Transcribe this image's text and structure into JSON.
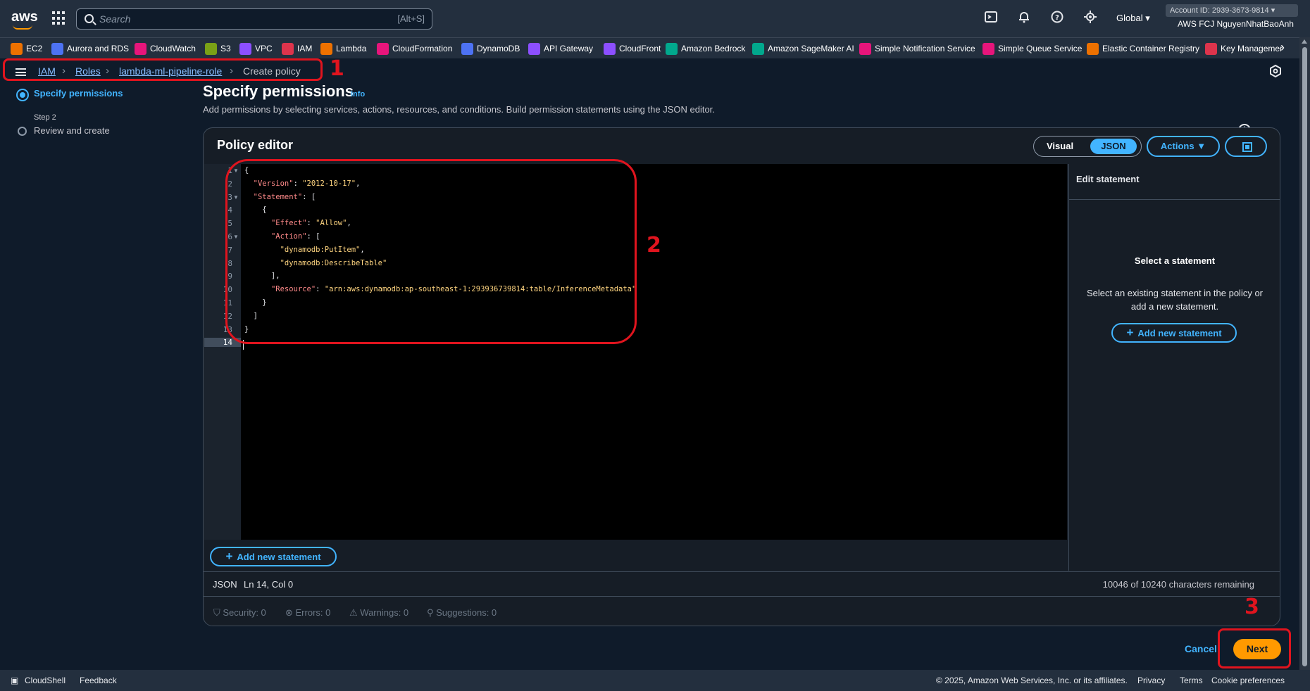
{
  "topbar": {
    "logo": "aws",
    "search_placeholder": "Search",
    "search_shortcut": "[Alt+S]",
    "region": "Global ▾",
    "account_id": "Account ID: 2939-3673-9814 ▾",
    "user": "AWS FCJ NguyenNhatBaoAnh"
  },
  "favorites": [
    {
      "label": "EC2",
      "color": "#ed7100"
    },
    {
      "label": "Aurora and RDS",
      "color": "#4d72f3"
    },
    {
      "label": "CloudWatch",
      "color": "#e7157b"
    },
    {
      "label": "S3",
      "color": "#7aa116"
    },
    {
      "label": "VPC",
      "color": "#8c4fff"
    },
    {
      "label": "IAM",
      "color": "#dd344c"
    },
    {
      "label": "Lambda",
      "color": "#ed7100"
    },
    {
      "label": "CloudFormation",
      "color": "#e7157b"
    },
    {
      "label": "DynamoDB",
      "color": "#4d72f3"
    },
    {
      "label": "API Gateway",
      "color": "#8c4fff"
    },
    {
      "label": "CloudFront",
      "color": "#8c4fff"
    },
    {
      "label": "Amazon Bedrock",
      "color": "#01a88d"
    },
    {
      "label": "Amazon SageMaker AI",
      "color": "#01a88d"
    },
    {
      "label": "Simple Notification Service",
      "color": "#e7157b"
    },
    {
      "label": "Simple Queue Service",
      "color": "#e7157b"
    },
    {
      "label": "Elastic Container Registry",
      "color": "#ed7100"
    },
    {
      "label": "Key Managemer",
      "color": "#dd344c"
    }
  ],
  "breadcrumb": [
    "IAM",
    "Roles",
    "lambda-ml-pipeline-role",
    "Create policy"
  ],
  "steps": {
    "step1": "Specify permissions",
    "step2_num": "Step 2",
    "step2": "Review and create"
  },
  "page": {
    "title": "Specify permissions",
    "info": "Info",
    "description": "Add permissions by selecting services, actions, resources, and conditions. Build permission statements using the JSON editor."
  },
  "editor": {
    "title": "Policy editor",
    "visual": "Visual",
    "json": "JSON",
    "actions": "Actions ▼",
    "lines": [
      {
        "n": "1",
        "text": "{"
      },
      {
        "n": "2",
        "text": "  \"Version\": \"2012-10-17\","
      },
      {
        "n": "3",
        "text": "  \"Statement\": ["
      },
      {
        "n": "4",
        "text": "    {"
      },
      {
        "n": "5",
        "text": "      \"Effect\": \"Allow\","
      },
      {
        "n": "6",
        "text": "      \"Action\": ["
      },
      {
        "n": "7",
        "text": "        \"dynamodb:PutItem\","
      },
      {
        "n": "8",
        "text": "        \"dynamodb:DescribeTable\""
      },
      {
        "n": "9",
        "text": "      ],"
      },
      {
        "n": "10",
        "text": "      \"Resource\": \"arn:aws:dynamodb:ap-southeast-1:293936739814:table/InferenceMetadata\""
      },
      {
        "n": "11",
        "text": "    }"
      },
      {
        "n": "12",
        "text": "  ]"
      },
      {
        "n": "13",
        "text": "}"
      },
      {
        "n": "14",
        "text": ""
      }
    ],
    "add_statement": "Add new statement",
    "status_mode": "JSON",
    "status_pos": "Ln 14, Col 0",
    "chars_remaining": "10046 of 10240 characters remaining",
    "checks": [
      "Security: 0",
      "Errors: 0",
      "Warnings: 0",
      "Suggestions: 0"
    ]
  },
  "edit_statement": {
    "title": "Edit statement",
    "select_title": "Select a statement",
    "select_desc": "Select an existing statement in the policy or add a new statement.",
    "add": "Add new statement"
  },
  "actions": {
    "cancel": "Cancel",
    "next": "Next"
  },
  "annotations": [
    "1",
    "2",
    "3"
  ],
  "footer": {
    "cloudshell": "CloudShell",
    "feedback": "Feedback",
    "copyright": "© 2025, Amazon Web Services, Inc. or its affiliates.",
    "privacy": "Privacy",
    "terms": "Terms",
    "cookies": "Cookie preferences"
  }
}
